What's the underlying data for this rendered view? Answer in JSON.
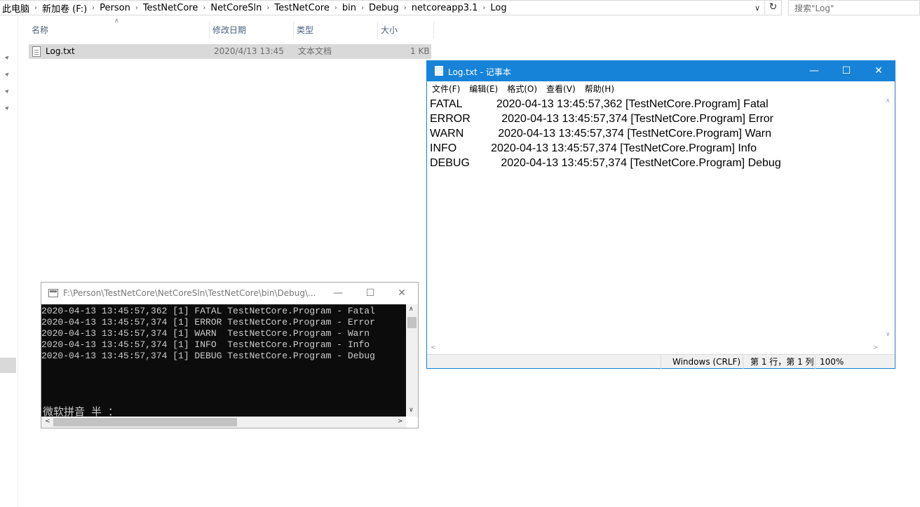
{
  "explorer": {
    "breadcrumbs": [
      "此电脑",
      "新加卷 (F:)",
      "Person",
      "TestNetCore",
      "NetCoreSln",
      "TestNetCore",
      "bin",
      "Debug",
      "netcoreapp3.1",
      "Log"
    ],
    "search_placeholder": "搜索\"Log\"",
    "columns": {
      "name": "名称",
      "date": "修改日期",
      "type": "类型",
      "size": "大小"
    },
    "file": {
      "name": "Log.txt",
      "date": "2020/4/13 13:45",
      "type": "文本文档",
      "size": "1 KB"
    }
  },
  "notepad": {
    "title": "Log.txt - 记事本",
    "menu": [
      "文件(F)",
      "编辑(E)",
      "格式(O)",
      "查看(V)",
      "帮助(H)"
    ],
    "lines": [
      "FATAL           2020-04-13 13:45:57,362 [TestNetCore.Program] Fatal",
      "ERROR          2020-04-13 13:45:57,374 [TestNetCore.Program] Error",
      "WARN           2020-04-13 13:45:57,374 [TestNetCore.Program] Warn",
      "INFO           2020-04-13 13:45:57,374 [TestNetCore.Program] Info",
      "DEBUG          2020-04-13 13:45:57,374 [TestNetCore.Program] Debug"
    ],
    "status": {
      "encoding": "Windows (CRLF)",
      "position": "第 1 行，第 1 列",
      "zoom": "100%"
    }
  },
  "console": {
    "title": "F:\\Person\\TestNetCore\\NetCoreSln\\TestNetCore\\bin\\Debug\\...",
    "lines": [
      "2020-04-13 13:45:57,362 [1] FATAL TestNetCore.Program - Fatal",
      "2020-04-13 13:45:57,374 [1] ERROR TestNetCore.Program - Error",
      "2020-04-13 13:45:57,374 [1] WARN  TestNetCore.Program - Warn",
      "2020-04-13 13:45:57,374 [1] INFO  TestNetCore.Program - Info",
      "2020-04-13 13:45:57,374 [1] DEBUG TestNetCore.Program - Debug"
    ],
    "ime_status": "微软拼音 半 ："
  }
}
